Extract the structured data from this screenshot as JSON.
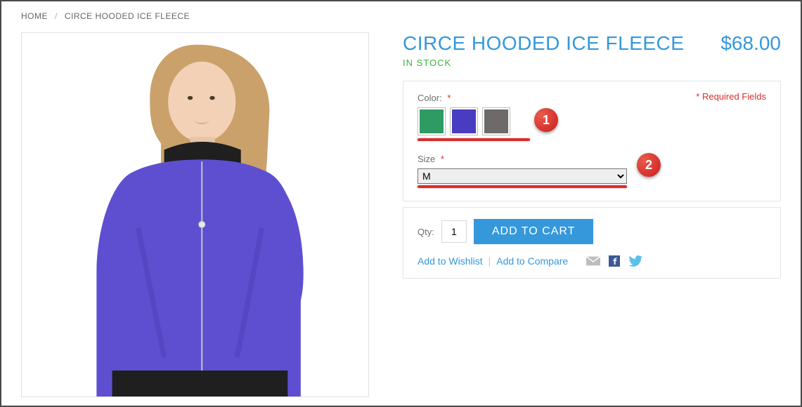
{
  "breadcrumb": {
    "home": "HOME",
    "current": "CIRCE HOODED ICE FLEECE"
  },
  "product": {
    "title": "CIRCE HOODED ICE FLEECE",
    "price": "$68.00",
    "stock": "IN STOCK"
  },
  "options": {
    "required_fields": "* Required Fields",
    "color": {
      "label": "Color:",
      "swatches": [
        {
          "name": "green",
          "hex": "#2e9b63"
        },
        {
          "name": "purple",
          "hex": "#4a3cc0"
        },
        {
          "name": "gray",
          "hex": "#6e6a6a"
        }
      ]
    },
    "size": {
      "label": "Size",
      "selected": "M"
    }
  },
  "cart": {
    "qty_label": "Qty:",
    "qty_value": "1",
    "add_button": "ADD TO CART"
  },
  "links": {
    "wishlist": "Add to Wishlist",
    "compare": "Add to Compare"
  },
  "callouts": {
    "one": "1",
    "two": "2"
  }
}
